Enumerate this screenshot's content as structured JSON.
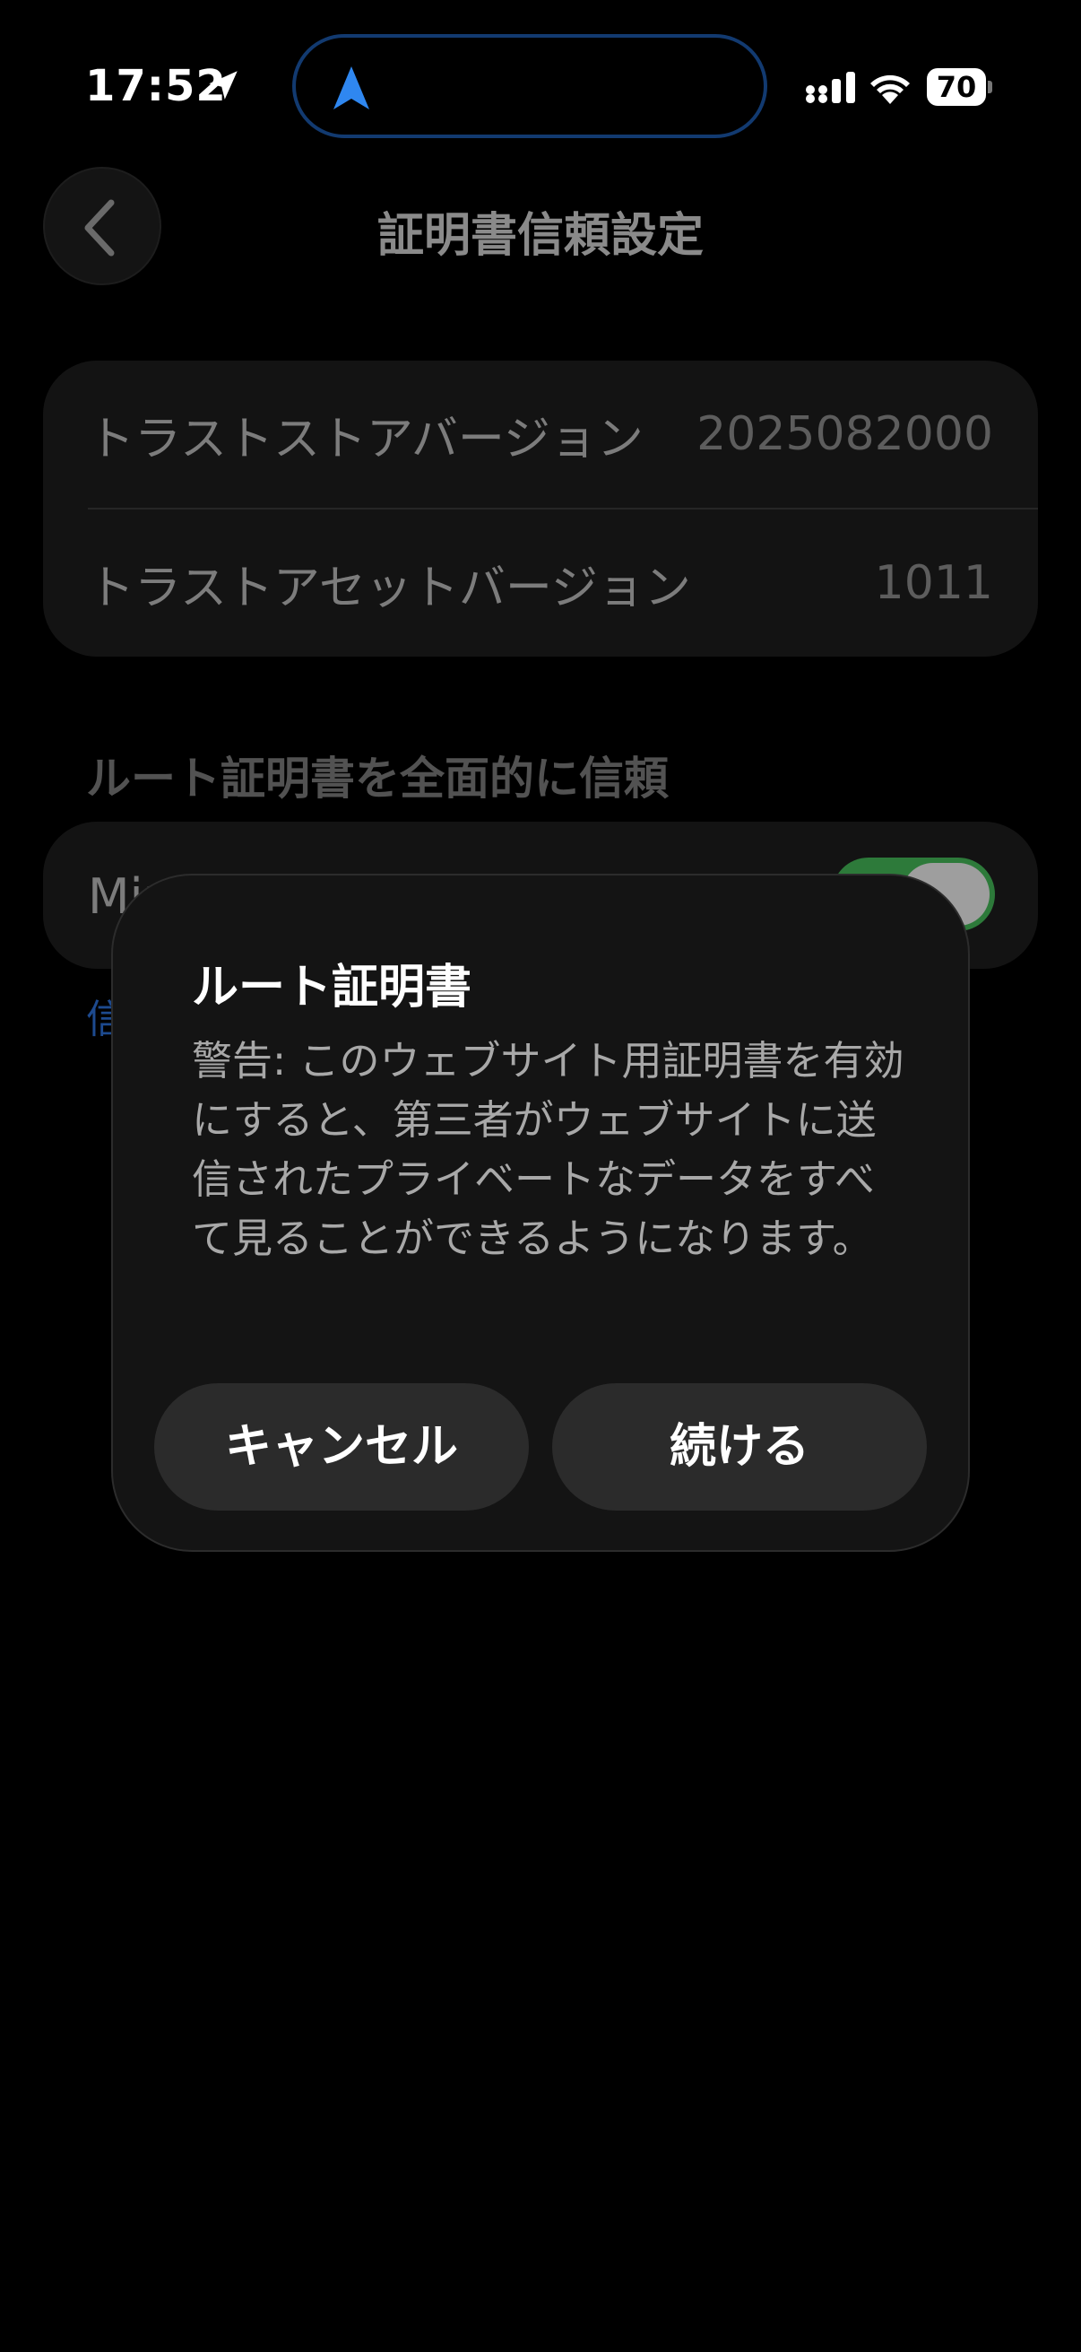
{
  "status_bar": {
    "time": "17:52",
    "battery": "70"
  },
  "header": {
    "title": "証明書信頼設定"
  },
  "info": {
    "rows": [
      {
        "label": "トラストストアバージョン",
        "value": "2025082000"
      },
      {
        "label": "トラストアセットバージョン",
        "value": "1011"
      }
    ]
  },
  "section": {
    "header": "ルート証明書を全面的に信頼",
    "toggle_label": "Mir",
    "footer_link": "信"
  },
  "alert": {
    "title": "ルート証明書",
    "message": "警告: このウェブサイト用証明書を有効にすると、第三者がウェブサイトに送信されたプライベートなデータをすべて見ることができるようになります。",
    "cancel_label": "キャンセル",
    "continue_label": "続ける"
  },
  "colors": {
    "accent_blue": "#2f87f0",
    "toggle_green": "#2d7a3a"
  }
}
